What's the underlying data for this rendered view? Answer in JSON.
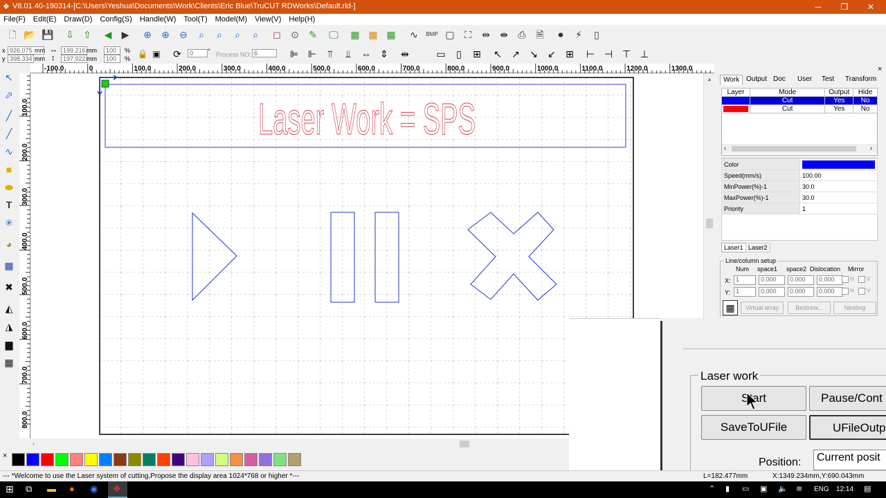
{
  "window": {
    "title": "V8.01.40-190314-[C:\\Users\\Yeshua\\Documents\\Work\\Clients\\Eric Blue\\TruCUT RDWorks\\Default.rld-]",
    "minimize": "─",
    "restore": "❐",
    "close": "✕"
  },
  "menu": [
    "File(F)",
    "Edit(E)",
    "Draw(D)",
    "Config(S)",
    "Handle(W)",
    "Tool(T)",
    "Model(M)",
    "View(V)",
    "Help(H)"
  ],
  "size_panel": {
    "x_label": "x",
    "y_label": "y",
    "x_value": "926.075",
    "y_value": "398.334",
    "unit": "mm",
    "width": "199.216",
    "height": "197.922",
    "scale_x": "100",
    "scale_y": "100",
    "percent": "%",
    "rotate": "0",
    "degree": "°",
    "process_no_label": "Process NO:",
    "process_no": "6"
  },
  "hruler": [
    "-100.0",
    "0",
    "100.0",
    "200.0",
    "300.0",
    "400.0",
    "500.0",
    "600.0",
    "700.0",
    "800.0",
    "900.0",
    "1000.0",
    "1100.0",
    "1200.0",
    "1300.0"
  ],
  "vruler": [
    "100.0",
    "200.0",
    "300.0",
    "400.0",
    "500.0",
    "600.0",
    "700.0",
    "800.0"
  ],
  "canvas": {
    "title_text": "Laser Work = SPS",
    "title_color": "#d23a48",
    "shape_color": "#2233cc"
  },
  "palette": [
    "#000000",
    "#0000ff",
    "#ff0000",
    "#00ff00",
    "#ff8080",
    "#ffff00",
    "#0080ff",
    "#8b3a14",
    "#8a8a00",
    "#008060",
    "#ff4000",
    "#400080",
    "#ffc0e0",
    "#b0a0ff",
    "#d0ff80",
    "#f09040",
    "#d060a0",
    "#9070e0",
    "#80e080",
    "#b0a070"
  ],
  "palette_close": "×",
  "status": {
    "message": "--- *Welcome to use the Laser system of cutting,Propose the display area 1024*768 or higher *---",
    "length": "L=182.477mm",
    "coords": "X:1349.234mm,Y:690.043mm"
  },
  "right_panel": {
    "tabs": [
      "Work",
      "Output",
      "Doc",
      "User",
      "Test",
      "Transform"
    ],
    "close": "×",
    "layer_headers": [
      "Layer",
      "Mode",
      "Output",
      "Hide"
    ],
    "layers": [
      {
        "color": "#0000ff",
        "mode": "Cut",
        "output": "Yes",
        "hide": "No"
      },
      {
        "color": "#ff0000",
        "mode": "Cut",
        "output": "Yes",
        "hide": "No"
      }
    ],
    "props": [
      {
        "label": "Color",
        "value": ""
      },
      {
        "label": "Speed(mm/s)",
        "value": "100.00"
      },
      {
        "label": "MinPower(%)-1",
        "value": "30.0"
      },
      {
        "label": "MaxPower(%)-1",
        "value": "30.0"
      },
      {
        "label": "Priority",
        "value": "1"
      }
    ],
    "prop_color": "#0000ff",
    "laser_tabs": [
      "Laser1",
      "Laser2"
    ],
    "array_group": "Line/column setup",
    "array_headers": [
      "Num",
      "space1",
      "space2",
      "Dislocation",
      "Mirror"
    ],
    "x_label": "X:",
    "y_label": "Y:",
    "num": "1",
    "space": "0.000",
    "mirror_h": "H",
    "mirror_v": "V",
    "virtual_array": "Virtual array",
    "bestrew": "Bestrew...",
    "nesting": "Nesting"
  },
  "laser_work": {
    "group": "Laser work",
    "start": "Start",
    "pause": "Pause/Cont",
    "save_ufile": "SaveToUFile",
    "ufile_output": "UFileOutp",
    "position_label": "Position:",
    "position_value": "Current posit"
  },
  "taskbar": {
    "lang": "ENG",
    "time": "12:14"
  }
}
